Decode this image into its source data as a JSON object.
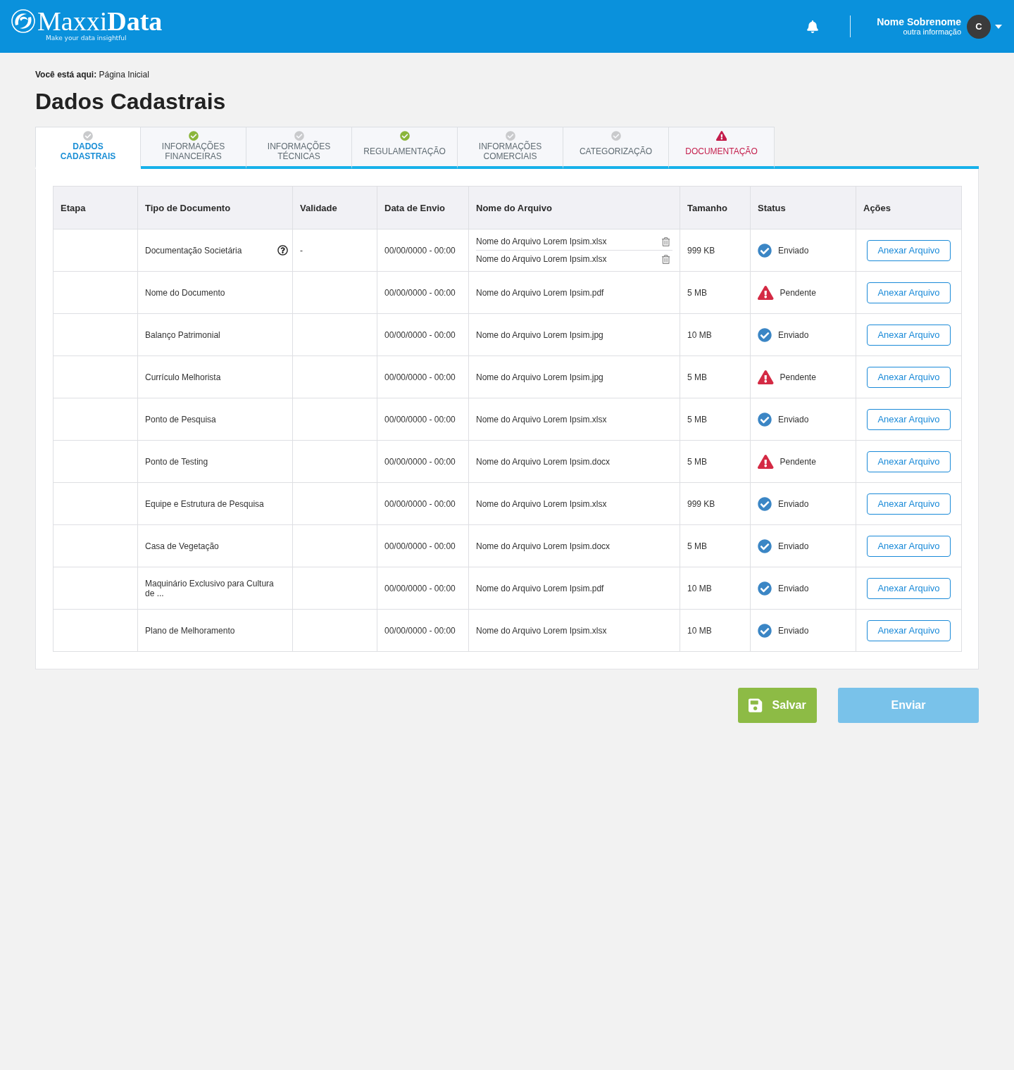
{
  "header": {
    "logo": {
      "wordmark": "Maxxi**Data**",
      "tagline": "Make your data insightful"
    },
    "user": {
      "name": "Nome Sobrenome",
      "info": "outra informação",
      "initial": "C"
    }
  },
  "breadcrumb": "**Você está aqui:** Página Inicial",
  "title": "Dados Cadastrais",
  "tabs": [
    {
      "label": "DADOS CADASTRAIS",
      "selected": true,
      "kind": "neutral"
    },
    {
      "label": "INFORMAÇÕES FINANCEIRAS",
      "selected": false,
      "kind": "complete"
    },
    {
      "label": "INFORMAÇÕES TÉCNICAS",
      "selected": false,
      "kind": "neutral"
    },
    {
      "label": "REGULAMENTAÇÃO",
      "selected": false,
      "kind": "complete"
    },
    {
      "label": "INFORMAÇÕES COMERCIAIS",
      "selected": false,
      "kind": "neutral"
    },
    {
      "label": "CATEGORIZAÇÃO",
      "selected": false,
      "kind": "neutral"
    },
    {
      "label": "DOCUMENTAÇÃO",
      "selected": false,
      "kind": "error"
    }
  ],
  "table": {
    "columns": [
      "Etapa",
      "Tipo de Documento",
      "Validade",
      "Data de Envio",
      "Nome do Arquivo",
      "Tamanho",
      "Status",
      "Ações"
    ],
    "rows": [
      {
        "type": "Documentação Societária",
        "help": true,
        "validity": "-",
        "date": "00/00/0000 - 00:00",
        "files": [
          {
            "name": "Nome do Arquivo Lorem Ipsim.xlsx",
            "deletable": true
          },
          {
            "name": "Nome do Arquivo Lorem Ipsim.xlsx",
            "deletable": true
          }
        ],
        "size": "999 KB",
        "status": {
          "kind": "sent",
          "label": "Enviado"
        },
        "action": "Anexar Arquivo"
      },
      {
        "type": "Nome do Documento",
        "help": false,
        "date": "00/00/0000 - 00:00",
        "files": [
          {
            "name": "Nome do Arquivo Lorem Ipsim.pdf",
            "deletable": false
          }
        ],
        "size": "5 MB",
        "status": {
          "kind": "pending",
          "label": "Pendente"
        },
        "action": "Anexar Arquivo"
      },
      {
        "type": "Balanço Patrimonial",
        "help": false,
        "date": "00/00/0000 - 00:00",
        "files": [
          {
            "name": "Nome do Arquivo Lorem Ipsim.jpg",
            "deletable": false
          }
        ],
        "size": "10 MB",
        "status": {
          "kind": "sent",
          "label": "Enviado"
        },
        "action": "Anexar Arquivo"
      },
      {
        "type": "Currículo Melhorista",
        "help": false,
        "date": "00/00/0000 - 00:00",
        "files": [
          {
            "name": "Nome do Arquivo Lorem Ipsim.jpg",
            "deletable": false
          }
        ],
        "size": "5 MB",
        "status": {
          "kind": "pending",
          "label": "Pendente"
        },
        "action": "Anexar Arquivo"
      },
      {
        "type": "Ponto de Pesquisa",
        "help": false,
        "date": "00/00/0000 - 00:00",
        "files": [
          {
            "name": "Nome do Arquivo Lorem Ipsim.xlsx",
            "deletable": false
          }
        ],
        "size": "5 MB",
        "status": {
          "kind": "sent",
          "label": "Enviado"
        },
        "action": "Anexar Arquivo"
      },
      {
        "type": "Ponto de Testing",
        "help": false,
        "date": "00/00/0000 - 00:00",
        "files": [
          {
            "name": "Nome do Arquivo Lorem Ipsim.docx",
            "deletable": false
          }
        ],
        "size": "5 MB",
        "status": {
          "kind": "pending",
          "label": "Pendente"
        },
        "action": "Anexar Arquivo"
      },
      {
        "type": "Equipe e Estrutura de Pesquisa",
        "help": false,
        "date": "00/00/0000 - 00:00",
        "files": [
          {
            "name": "Nome do Arquivo Lorem Ipsim.xlsx",
            "deletable": false
          }
        ],
        "size": "999 KB",
        "status": {
          "kind": "sent",
          "label": "Enviado"
        },
        "action": "Anexar Arquivo"
      },
      {
        "type": "Casa de Vegetação",
        "help": false,
        "date": "00/00/0000 - 00:00",
        "files": [
          {
            "name": "Nome do Arquivo Lorem Ipsim.docx",
            "deletable": false
          }
        ],
        "size": "5 MB",
        "status": {
          "kind": "sent",
          "label": "Enviado"
        },
        "action": "Anexar Arquivo"
      },
      {
        "type": "Maquinário Exclusivo para Cultura de ...",
        "help": false,
        "date": "00/00/0000 - 00:00",
        "files": [
          {
            "name": "Nome do Arquivo Lorem Ipsim.pdf",
            "deletable": false
          }
        ],
        "size": "10 MB",
        "status": {
          "kind": "sent",
          "label": "Enviado"
        },
        "action": "Anexar Arquivo"
      },
      {
        "type": "Plano de Melhoramento",
        "help": false,
        "date": "00/00/0000 - 00:00",
        "files": [
          {
            "name": "Nome do Arquivo Lorem Ipsim.xlsx",
            "deletable": false
          }
        ],
        "size": "10 MB",
        "status": {
          "kind": "sent",
          "label": "Enviado"
        },
        "action": "Anexar Arquivo"
      }
    ]
  },
  "buttons": [
    {
      "kind": "save",
      "label": "Salvar",
      "disabled": false
    },
    {
      "kind": "send",
      "label": "Enviar",
      "disabled": true
    }
  ]
}
